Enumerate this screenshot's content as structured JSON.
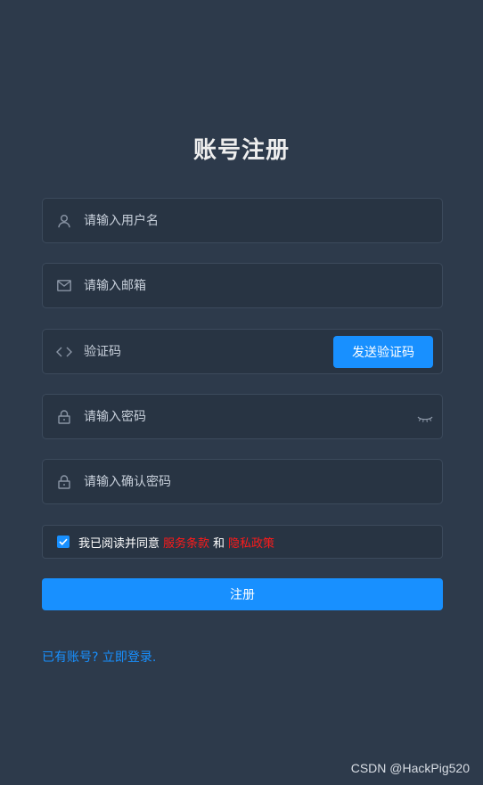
{
  "title": "账号注册",
  "fields": {
    "username": {
      "placeholder": "请输入用户名",
      "icon": "user-icon"
    },
    "email": {
      "placeholder": "请输入邮箱",
      "icon": "mail-icon"
    },
    "code": {
      "placeholder": "验证码",
      "icon": "code-icon",
      "button_label": "发送验证码"
    },
    "password": {
      "placeholder": "请输入密码",
      "icon": "lock-icon",
      "toggle_icon": "eye-closed-icon"
    },
    "confirm": {
      "placeholder": "请输入确认密码",
      "icon": "lock-icon"
    }
  },
  "agreement": {
    "checked": true,
    "prefix": "我已阅读并同意",
    "terms": "服务条款",
    "and": "和",
    "privacy": "隐私政策"
  },
  "submit_label": "注册",
  "login_link": "已有账号? 立即登录.",
  "watermark": "CSDN @HackPig520",
  "colors": {
    "background": "#2d3a4b",
    "field_bg": "#283443",
    "primary": "#1890ff",
    "link_red": "#ff1a1a"
  }
}
